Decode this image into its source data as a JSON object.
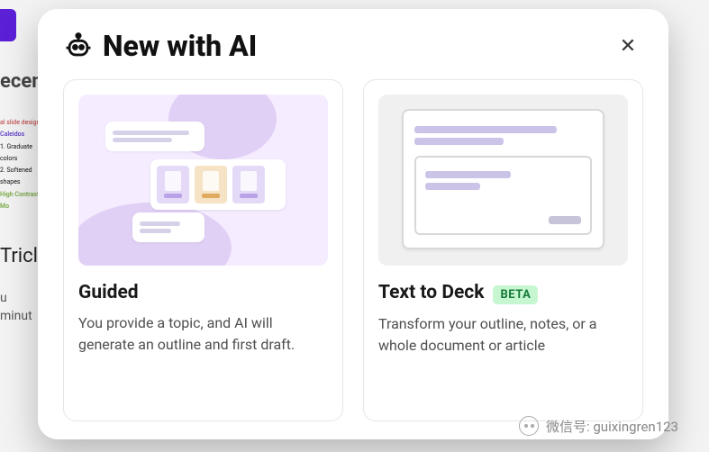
{
  "background": {
    "recent_label": "ecentl",
    "trick_label": "Tricl",
    "u_label": "u",
    "minute_label": "minut"
  },
  "modal": {
    "title": "New with AI",
    "close_label": "✕",
    "cards": [
      {
        "id": "guided",
        "title": "Guided",
        "description": "You provide a topic, and AI will generate an outline and first draft.",
        "badge": null
      },
      {
        "id": "text-to-deck",
        "title": "Text to Deck",
        "description": "Transform your outline, notes, or a whole document or article",
        "badge": "BETA"
      }
    ]
  },
  "watermark": {
    "label": "微信号: guixingren123"
  }
}
